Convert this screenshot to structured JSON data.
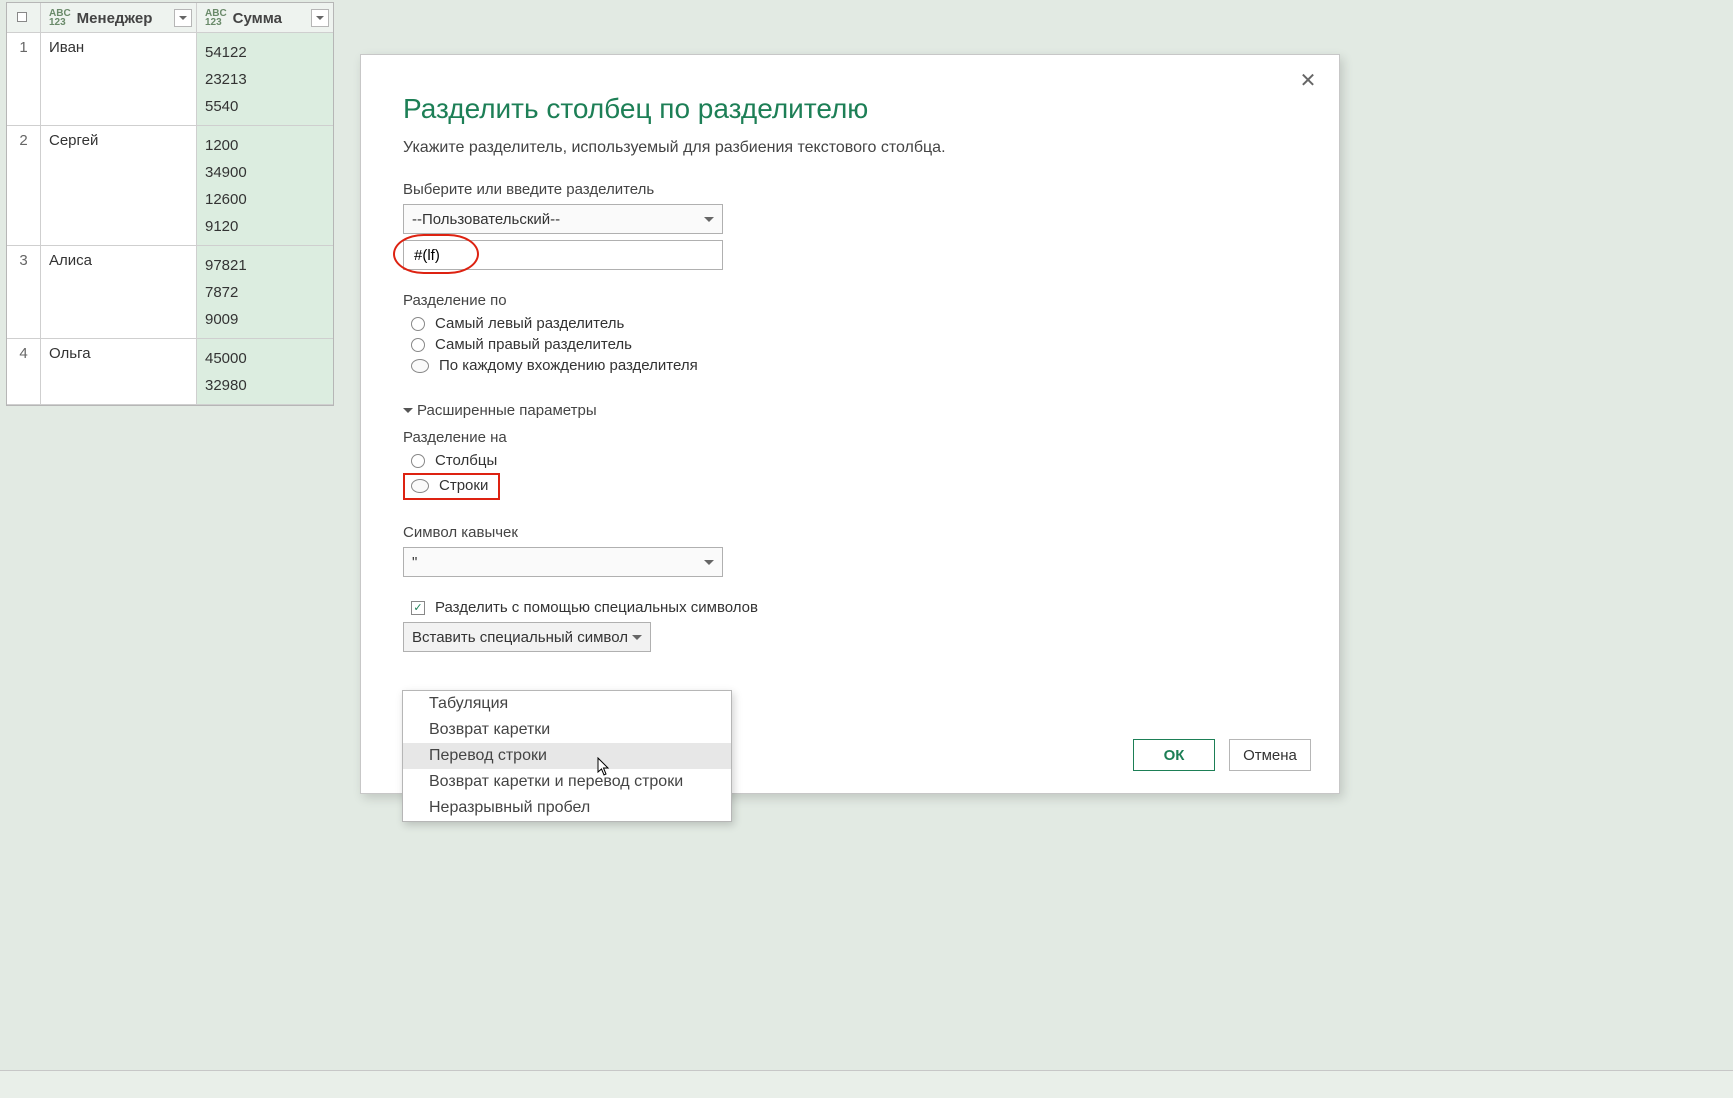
{
  "table": {
    "col1": "Менеджер",
    "col2": "Сумма",
    "type_label_top": "ABC",
    "type_label_bot": "123",
    "rows": [
      {
        "idx": "1",
        "mgr": "Иван",
        "sum": "54122\n23213\n5540"
      },
      {
        "idx": "2",
        "mgr": "Сергей",
        "sum": "1200\n34900\n12600\n9120"
      },
      {
        "idx": "3",
        "mgr": "Алиса",
        "sum": "97821\n7872\n9009"
      },
      {
        "idx": "4",
        "mgr": "Ольга",
        "sum": "45000\n32980"
      }
    ]
  },
  "dialog": {
    "title": "Разделить столбец по разделителю",
    "subtitle": "Укажите разделитель, используемый для разбиения текстового столбца.",
    "delim_label": "Выберите или введите разделитель",
    "delim_select": "--Пользовательский--",
    "delim_value": "#(lf)",
    "split_by_label": "Разделение по",
    "split_by": {
      "left": "Самый левый разделитель",
      "right": "Самый правый разделитель",
      "each": "По каждому вхождению разделителя"
    },
    "advanced": "Расширенные параметры",
    "split_into_label": "Разделение на",
    "split_into": {
      "cols": "Столбцы",
      "rows": "Строки"
    },
    "quote_label": "Символ кавычек",
    "quote_value": "\"",
    "special_check": "Разделить с помощью специальных символов",
    "special_btn": "Вставить специальный символ",
    "special_menu": [
      "Табуляция",
      "Возврат каретки",
      "Перевод строки",
      "Возврат каретки и перевод строки",
      "Неразрывный пробел"
    ],
    "hover_index": 2,
    "ok": "ОК",
    "cancel": "Отмена"
  }
}
